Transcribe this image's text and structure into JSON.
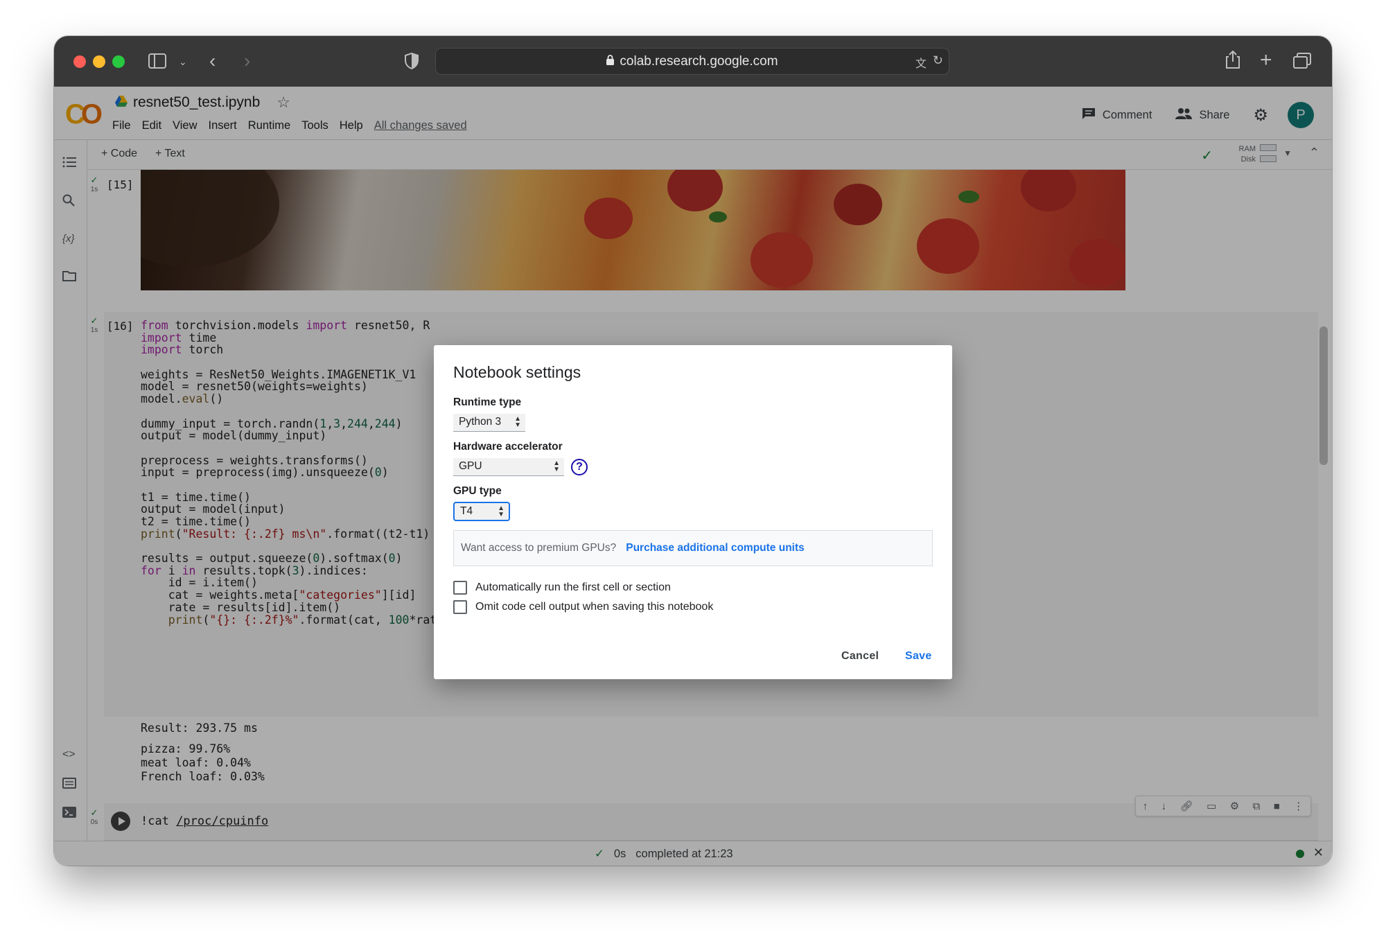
{
  "browser": {
    "url": "colab.research.google.com"
  },
  "colab": {
    "notebook_title": "resnet50_test.ipynb",
    "menus": [
      "File",
      "Edit",
      "View",
      "Insert",
      "Runtime",
      "Tools",
      "Help"
    ],
    "save_status": "All changes saved",
    "comment_label": "Comment",
    "share_label": "Share",
    "avatar_letter": "P",
    "add_code_label": "+ Code",
    "add_text_label": "+ Text",
    "ram_label": "RAM",
    "disk_label": "Disk"
  },
  "cells": {
    "cell15": {
      "exec_count": "[15]",
      "duration": "1s"
    },
    "cell16": {
      "exec_count": "[16]",
      "duration": "1s"
    },
    "cell17": {
      "duration": "0s",
      "code_prefix": "!cat ",
      "code_path": "/proc/cpuinfo"
    }
  },
  "code_lines": [
    "from torchvision.models import resnet50, R",
    "import time",
    "import torch",
    "",
    "weights = ResNet50_Weights.IMAGENET1K_V1",
    "model = resnet50(weights=weights)",
    "model.eval()",
    "",
    "dummy_input = torch.randn(1,3,244,244)",
    "output = model(dummy_input)",
    "",
    "preprocess = weights.transforms()",
    "input = preprocess(img).unsqueeze(0)",
    "",
    "t1 = time.time()",
    "output = model(input)",
    "t2 = time.time()",
    "print(\"Result: {:.2f} ms\\n\".format((t2-t1)",
    "",
    "results = output.squeeze(0).softmax(0)",
    "for i in results.topk(3).indices:",
    "    id = i.item()",
    "    cat = weights.meta[\"categories\"][id]",
    "    rate = results[id].item()",
    "    print(\"{}: {:.2f}%\".format(cat, 100*rate))"
  ],
  "output_lines": [
    "Result: 293.75 ms",
    "",
    "pizza: 99.76%",
    "meat loaf: 0.04%",
    "French loaf: 0.03%"
  ],
  "statusbar": {
    "duration": "0s",
    "completed": "completed at 21:23"
  },
  "dialog": {
    "title": "Notebook settings",
    "runtime_label": "Runtime type",
    "runtime_value": "Python 3",
    "accelerator_label": "Hardware accelerator",
    "accelerator_value": "GPU",
    "help_glyph": "?",
    "gpu_label": "GPU type",
    "gpu_value": "T4",
    "premium_text": "Want access to premium GPUs?",
    "premium_link": "Purchase additional compute units",
    "option_autorun": "Automatically run the first cell or section",
    "option_omit": "Omit code cell output when saving this notebook",
    "cancel_label": "Cancel",
    "save_label": "Save"
  }
}
